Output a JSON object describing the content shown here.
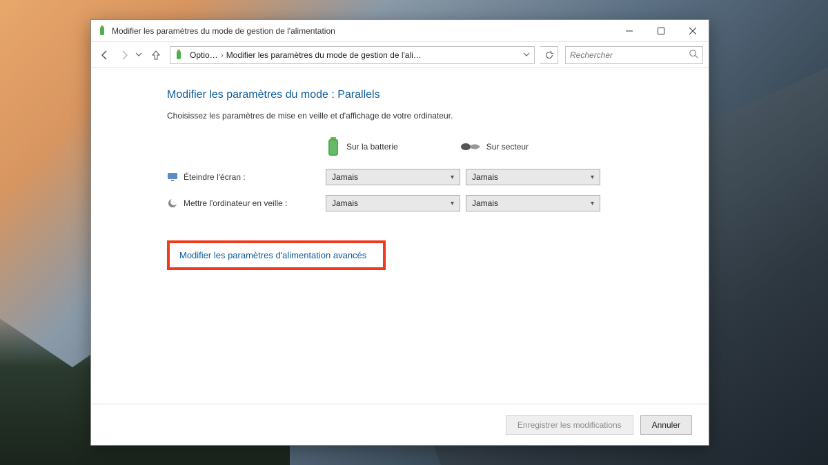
{
  "window": {
    "title": "Modifier les paramètres du mode de gestion de l'alimentation"
  },
  "breadcrumb": {
    "seg1": "Optio…",
    "seg2": "Modifier les paramètres du mode de gestion de l'ali…"
  },
  "search": {
    "placeholder": "Rechercher"
  },
  "page": {
    "heading": "Modifier les paramètres du mode : Parallels",
    "description": "Choisissez les paramètres de mise en veille et d'affichage de votre ordinateur."
  },
  "columns": {
    "battery": "Sur la batterie",
    "plugged": "Sur secteur"
  },
  "settings": {
    "display_off": {
      "label": "Éteindre l'écran :",
      "battery": "Jamais",
      "plugged": "Jamais"
    },
    "sleep": {
      "label": "Mettre l'ordinateur en veille :",
      "battery": "Jamais",
      "plugged": "Jamais"
    }
  },
  "links": {
    "advanced": "Modifier les paramètres d'alimentation avancés"
  },
  "buttons": {
    "save": "Enregistrer les modifications",
    "cancel": "Annuler"
  }
}
